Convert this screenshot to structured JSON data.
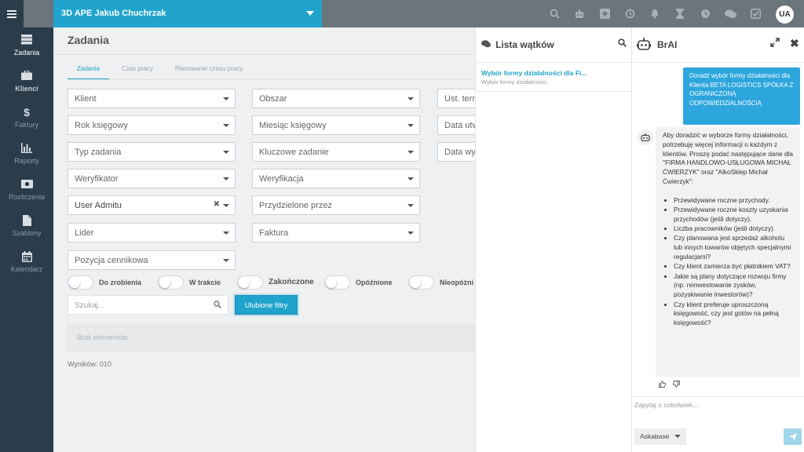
{
  "header": {
    "company": "3D APE Jakub Chuchrzak",
    "avatar_initials": "UA",
    "icons": [
      "search-icon",
      "robot-icon",
      "plus-square-icon",
      "history-icon",
      "bell-icon",
      "hourglass-icon",
      "clock-icon",
      "chat-icon",
      "checkbox-icon"
    ]
  },
  "sidebar": {
    "items": [
      {
        "label": "Zadania",
        "icon": "tasks-icon"
      },
      {
        "label": "Klienci",
        "icon": "briefcase-icon"
      },
      {
        "label": "Faktury",
        "icon": "dollar-icon"
      },
      {
        "label": "Raporty",
        "icon": "bar-chart-icon"
      },
      {
        "label": "Rozliczenia",
        "icon": "money-icon"
      },
      {
        "label": "Szablony",
        "icon": "file-icon"
      },
      {
        "label": "Kalendarz",
        "icon": "calendar-icon"
      }
    ]
  },
  "main": {
    "title": "Zadania",
    "tabs": [
      "Zadania",
      "Czas pracy",
      "Planowanie czasu pracy"
    ],
    "filters": {
      "klient": "Klient",
      "obszar": "Obszar",
      "ust_term": "Ust. term",
      "rok_ksiegowy": "Rok księgowy",
      "miesiac_ksiegowy": "Miesiąc księgowy",
      "data_utw": "Data utw",
      "typ_zadania": "Typ zadania",
      "kluczowe_zadanie": "Kluczowe zadanie",
      "data_wy": "Data wy",
      "weryfikator": "Weryfikator",
      "weryfikacja": "Weryfikacja",
      "user": "User Admitu",
      "przydzielone": "Przydzielone przez",
      "lider": "Lider",
      "faktura": "Faktura",
      "pozycja": "Pozycja cennikowa"
    },
    "toggles": [
      "Do zrobienia",
      "W trakcie",
      "Zakończone",
      "Opóźnione",
      "Nieopóźni"
    ],
    "search_placeholder": "Szukaj...",
    "favorite_filters": "Ulubione filtry",
    "empty": "Brak elementów.",
    "results": "Wyników: 010"
  },
  "threads": {
    "title": "Lista wątków",
    "items": [
      {
        "title": "Wybór formy działalności dla Fi...",
        "subtitle": "Wybór formy działalności"
      }
    ]
  },
  "brai": {
    "title": "BrAI",
    "user_message": "Doradź wybór formy działalności dla Klienta BETA LOGISTICS SPÓŁKA Z OGRANICZONĄ ODPOWIEDZIALNOŚCIĄ",
    "bot_intro": "Aby doradzić w wyborze formy działalności, potrzebuję więcej informacji o każdym z klientów. Proszę podać następujące dane dla \"FIRMA HANDLOWO-USŁUGOWA MICHAŁ ĆWIERZYK\" oraz \"AlkoSklep Michał Ćwierzyk\":",
    "bot_bullets": [
      "Przewidywane roczne przychody.",
      "Przewidywane roczne koszty uzyskania przychodów (jeśli dotyczy).",
      "Liczba pracowników (jeśli dotyczy).",
      "Czy planowana jest sprzedaż alkoholu lub innych towarów objętych specjalnymi regulacjami?",
      "Czy klient zamierza być płatnikiem VAT?",
      "Jakie są plany dotyczące rozwoju firmy (np. reinwestowanie zysków, pozyskiwanie inwestorów)?",
      "Czy klient preferuje uproszczoną księgowość, czy jest gotów na pełną księgowość?"
    ],
    "input_placeholder": "Zapytaj o cokolwiek...",
    "knowledge_base": "Askabase"
  },
  "colors": {
    "accent": "#20a3cc",
    "sidebar": "#2b3c4b",
    "topbar": "#6b757c",
    "user_bubble": "#2da6de"
  }
}
